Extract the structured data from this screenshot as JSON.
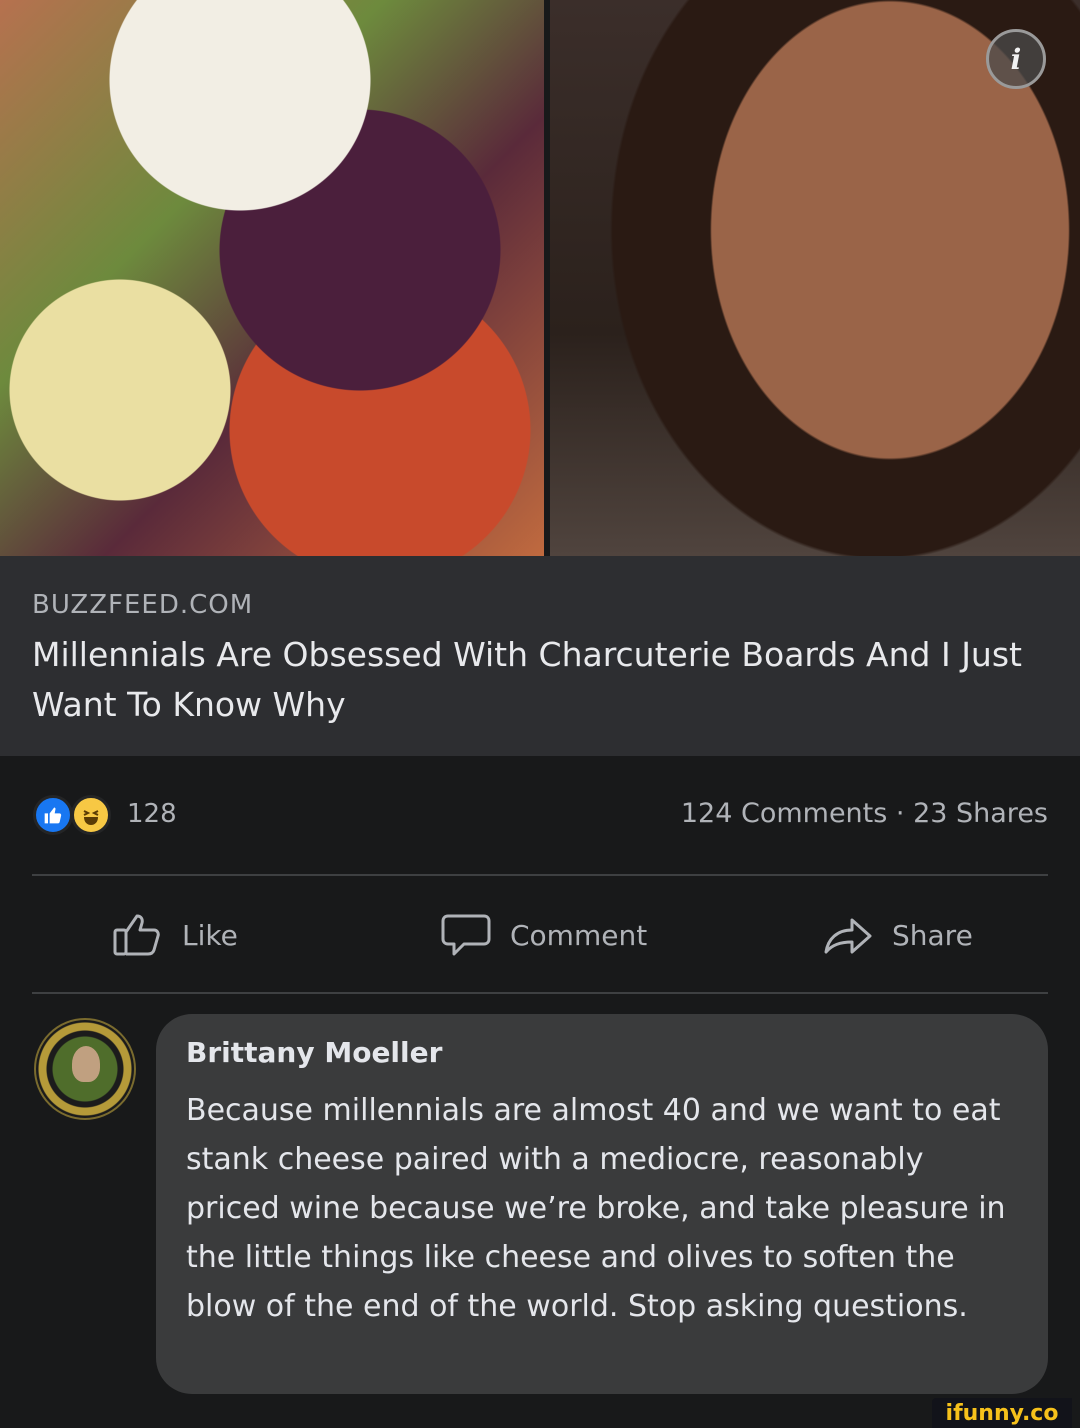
{
  "post": {
    "source": "BUZZFEED.COM",
    "headline": "Millennials Are Obsessed With Charcuterie Boards And I Just Want To Know Why"
  },
  "images": [
    {
      "name": "charcuterie-board-photo"
    },
    {
      "name": "woman-grimacing-photo"
    }
  ],
  "info_icon": "i",
  "stats": {
    "reaction_count": "128",
    "counts_text": "124 Comments · 23 Shares"
  },
  "actions": {
    "like": "Like",
    "comment": "Comment",
    "share": "Share"
  },
  "comment": {
    "author": "Brittany Moeller",
    "text": "Because millennials are almost 40 and we want to eat stank cheese paired with a mediocre, reasonably priced wine because we’re broke, and take pleasure  in the little things like cheese and olives to soften the blow of the end of the world. Stop asking questions."
  },
  "watermark": "ifunny.co",
  "colors": {
    "background": "#18191a",
    "card": "#2d2e31",
    "comment_bubble": "#3a3b3c",
    "like_blue": "#1877f2",
    "haha_yellow": "#f7c844"
  }
}
